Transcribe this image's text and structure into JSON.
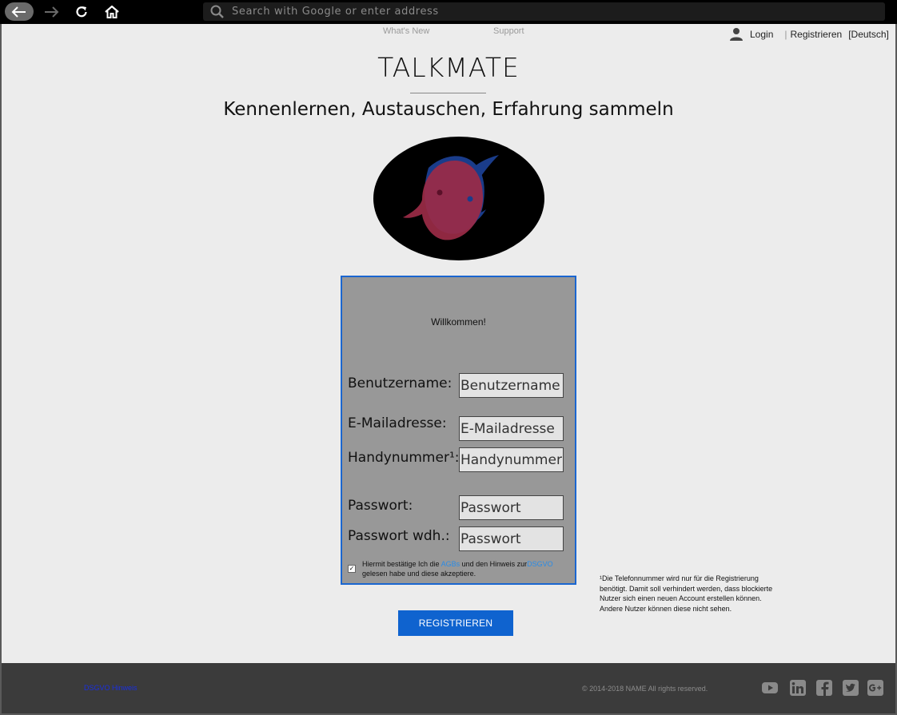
{
  "browser": {
    "address_placeholder": "Search with Google or enter address",
    "icons": [
      "back-arrow-icon",
      "forward-arrow-icon",
      "reload-icon",
      "home-icon",
      "search-icon"
    ]
  },
  "nav": {
    "whats_new": "What's New",
    "support": "Support",
    "login": "Login",
    "separator": "|",
    "register": "Registrieren",
    "language": "[Deutsch]"
  },
  "hero": {
    "title": "TALKMATE",
    "subtitle": "Kennenlernen, Austauschen, Erfahrung sammeln"
  },
  "form": {
    "welcome": "Willkommen!",
    "username_label": "Benutzername:",
    "username_placeholder": "Benutzername",
    "email_label": "E-Mailadresse:",
    "email_placeholder": "E-Mailadresse",
    "phone_label": "Handynummer¹:",
    "phone_placeholder": "Handynummer",
    "password_label": "Passwort:",
    "password_placeholder": "Passwort",
    "password_repeat_label": "Passwort wdh.:",
    "password_repeat_placeholder": "Passwort",
    "consent_checked": true,
    "consent_prefix": "Hiermit bestätige Ich die ",
    "consent_agb": "AGBs",
    "consent_middle": " und den Hinweis zur",
    "consent_dsgvo": "DSGVO",
    "consent_suffix": " gelesen habe und diese akzeptiere.",
    "submit": "REGISTRIEREN"
  },
  "footnote": "¹Die Telefonnummer wird nur für die Registrierung benötigt. Damit soll verhindert werden, dass blockierte Nutzer sich einen neuen Account erstellen können. Andere Nutzer können diese nicht sehen.",
  "footer": {
    "dsgvo_link": "DSGVO Hinweis",
    "copyright": "© 2014-2018 NAME All rights reserved.",
    "social_icons": [
      "youtube-icon",
      "linkedin-icon",
      "facebook-icon",
      "twitter-icon",
      "google-plus-icon"
    ]
  },
  "colors": {
    "accent": "#0f63cf",
    "form_background": "#989898",
    "page_background": "#ececec",
    "footer_background": "#3b3b3b",
    "link": "#2a8be6"
  }
}
